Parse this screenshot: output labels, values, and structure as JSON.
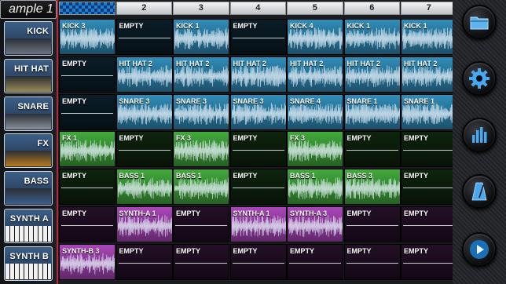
{
  "project": {
    "title": "ample 1"
  },
  "instruments": [
    {
      "label": "KICK",
      "thumb": "drum"
    },
    {
      "label": "HIT HAT",
      "thumb": "cymbal"
    },
    {
      "label": "SNARE",
      "thumb": "snare"
    },
    {
      "label": "FX",
      "thumb": "burst"
    },
    {
      "label": "BASS",
      "thumb": "bass-guitar"
    },
    {
      "label": "SYNTH A",
      "thumb": "keyboard"
    },
    {
      "label": "SYNTH B",
      "thumb": "keyboard"
    }
  ],
  "columns": [
    "",
    "2",
    "3",
    "4",
    "5",
    "6",
    "7"
  ],
  "row_colors": [
    "#2e86b0",
    "#2e86b0",
    "#2e86b0",
    "#3fa23a",
    "#3fa23a",
    "#a243b0",
    "#a243b0"
  ],
  "grid": [
    [
      "KICK 3",
      "EMPTY",
      "KICK 1",
      "EMPTY",
      "KICK 4",
      "KICK 1",
      "KICK 1"
    ],
    [
      "EMPTY",
      "HIT HAT 2",
      "HIT HAT 2",
      "HIT HAT 2",
      "HIT HAT 2",
      "HIT HAT 2",
      "HIT HAT 2"
    ],
    [
      "EMPTY",
      "SNARE 3",
      "SNARE 3",
      "SNARE 3",
      "SNARE 4",
      "SNARE 1",
      "SNARE 1"
    ],
    [
      "FX 1",
      "EMPTY",
      "FX 3",
      "EMPTY",
      "FX 3",
      "EMPTY",
      "EMPTY"
    ],
    [
      "EMPTY",
      "BASS 1",
      "BASS 1",
      "EMPTY",
      "BASS 1",
      "BASS 3",
      "EMPTY"
    ],
    [
      "EMPTY",
      "SYNTH-A 1",
      "EMPTY",
      "SYNTH-A 1",
      "SYNTH-A 3",
      "EMPTY",
      "EMPTY"
    ],
    [
      "SYNTH-B 3",
      "EMPTY",
      "EMPTY",
      "EMPTY",
      "EMPTY",
      "EMPTY",
      "EMPTY"
    ]
  ],
  "tools": [
    {
      "icon": "folder-icon"
    },
    {
      "icon": "gear-icon"
    },
    {
      "icon": "equalizer-icon"
    },
    {
      "icon": "metronome-icon"
    },
    {
      "icon": "play-icon"
    }
  ]
}
